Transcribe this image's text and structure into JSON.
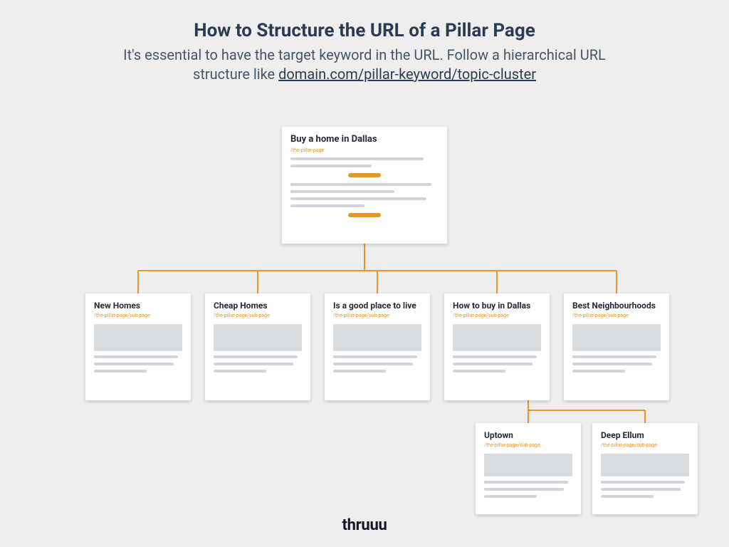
{
  "title": "How to Structure the URL of a Pillar Page",
  "subtitle_lead": "It's essential to have the target keyword in the URL. Follow a hierarchical URL structure like ",
  "subtitle_url": "domain.com/pillar-keyword/topic-cluster",
  "brand": "thruuu",
  "pillar": {
    "title": "Buy a home in Dallas",
    "path": "/the-pillar-page"
  },
  "topics": {
    "t1": {
      "title": "New Homes",
      "path": "/the-pillar-page/sub-page"
    },
    "t2": {
      "title": "Cheap Homes",
      "path": "/the-pillar-page/sub-page"
    },
    "t3": {
      "title": "Is a good place to live",
      "path": "/the-pillar-page/sub-page"
    },
    "t4": {
      "title": "How to buy in Dallas",
      "path": "/the-pillar-page/sub-page"
    },
    "t5": {
      "title": "Best Neighbourhoods",
      "path": "/the-pillar-page/sub-page"
    }
  },
  "subs": {
    "s1": {
      "title": "Uptown",
      "path": "/the-pillar-page/sub-page"
    },
    "s2": {
      "title": "Deep Ellum",
      "path": "/the-pillar-page/sub-page"
    }
  }
}
